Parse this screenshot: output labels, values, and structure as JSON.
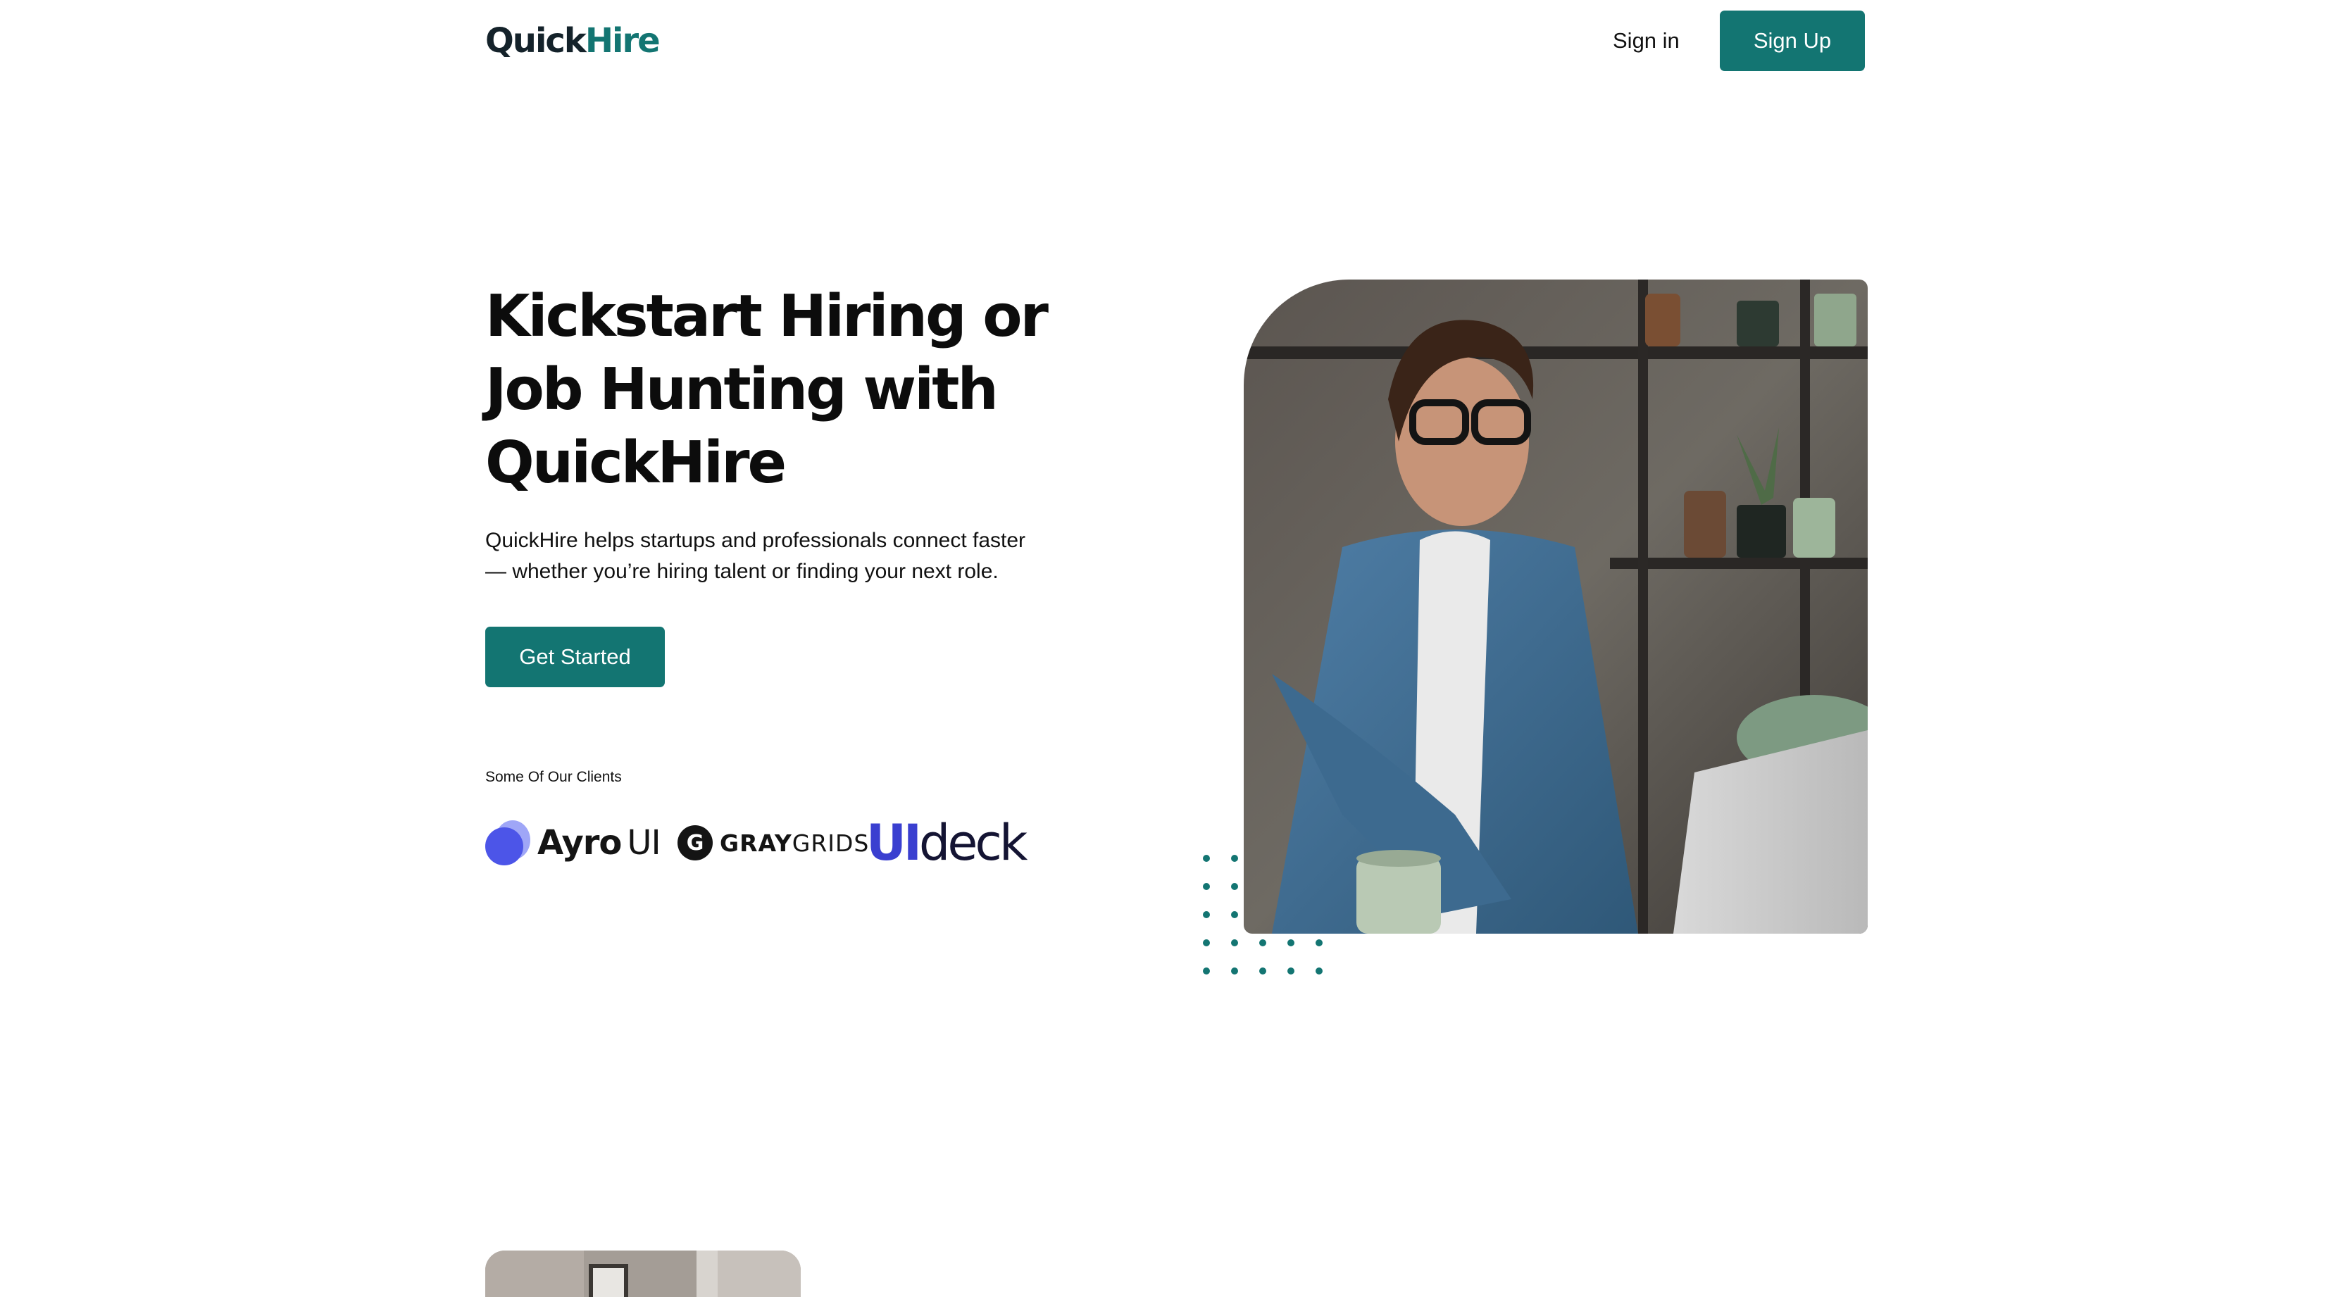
{
  "header": {
    "logo_part1": "Quick",
    "logo_part2": "Hire",
    "signin_label": "Sign in",
    "signup_label": "Sign Up"
  },
  "hero": {
    "title": "Kickstart Hiring or Job Hunting with QuickHire",
    "subtitle": "QuickHire helps startups and professionals connect faster — whether you’re hiring talent or finding your next role.",
    "cta_label": "Get Started",
    "photo_alt": "Man with glasses in a denim shirt typing on a laptop"
  },
  "clients": {
    "label": "Some Of Our Clients",
    "logos": [
      {
        "name": "Ayro UI",
        "part1": "Ayro",
        "part2": "UI"
      },
      {
        "name": "GrayGrids",
        "mark": "G",
        "part1": "GRAY",
        "part2": "GRIDS"
      },
      {
        "name": "UIdeck",
        "part1": "UI",
        "part2": "deck"
      }
    ]
  },
  "colors": {
    "brand": "#137572",
    "logo_dark": "#14222a",
    "ayro": "#4c55e8",
    "uideck": "#3a3fd0"
  }
}
